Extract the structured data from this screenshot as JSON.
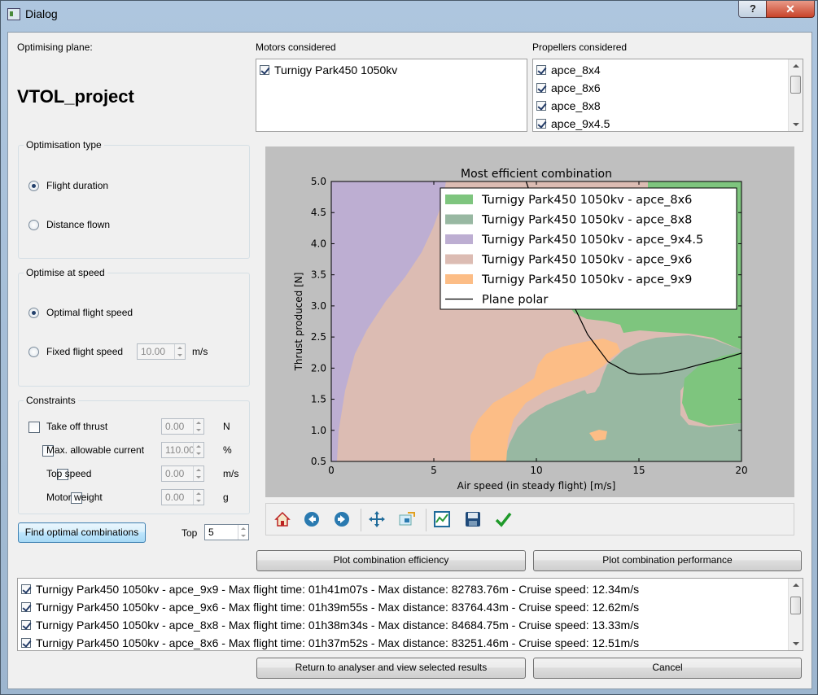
{
  "window": {
    "title": "Dialog",
    "help_label": "?",
    "close_label": "✕"
  },
  "plane": {
    "heading": "Optimising plane:",
    "name": "VTOL_project"
  },
  "motors": {
    "heading": "Motors considered",
    "items": [
      {
        "label": "Turnigy Park450 1050kv",
        "checked": true
      }
    ]
  },
  "propellers": {
    "heading": "Propellers considered",
    "items": [
      {
        "label": "apce_8x4",
        "checked": true
      },
      {
        "label": "apce_8x6",
        "checked": true
      },
      {
        "label": "apce_8x8",
        "checked": true
      },
      {
        "label": "apce_9x4.5",
        "checked": true
      }
    ]
  },
  "optimisation_type": {
    "title": "Optimisation type",
    "options": [
      {
        "label": "Flight duration",
        "selected": true
      },
      {
        "label": "Distance flown",
        "selected": false
      }
    ]
  },
  "optimise_speed": {
    "title": "Optimise at speed",
    "optimal_label": "Optimal flight speed",
    "fixed_label": "Fixed flight speed",
    "fixed_value": "10.00",
    "fixed_unit": "m/s",
    "selected": "optimal"
  },
  "constraints": {
    "title": "Constraints",
    "items": [
      {
        "label": "Take off thrust",
        "value": "0.00",
        "unit": "N"
      },
      {
        "label": "Max. allowable current",
        "value": "110.00",
        "unit": "%"
      },
      {
        "label": "Top speed",
        "value": "0.00",
        "unit": "m/s"
      },
      {
        "label": "Motor weight",
        "value": "0.00",
        "unit": "g"
      }
    ]
  },
  "find": {
    "button_label": "Find optimal combinations",
    "top_label": "Top",
    "top_value": "5"
  },
  "chart_data": {
    "type": "area",
    "title": "Most efficient combination",
    "xlabel": "Air speed (in steady flight) [m/s]",
    "ylabel": "Thrust produced [N]",
    "xlim": [
      0,
      20
    ],
    "ylim": [
      0.5,
      5.0
    ],
    "x_ticks": [
      "0",
      "5",
      "10",
      "15",
      "20"
    ],
    "y_ticks": [
      "0.5",
      "1.0",
      "1.5",
      "2.0",
      "2.5",
      "3.0",
      "3.5",
      "4.0",
      "4.5",
      "5.0"
    ],
    "legend_position": "top-right",
    "series": [
      {
        "name": "Turnigy Park450 1050kv - apce_8x6",
        "color": "#7ec57e"
      },
      {
        "name": "Turnigy Park450 1050kv - apce_8x8",
        "color": "#98b8a2"
      },
      {
        "name": "Turnigy Park450 1050kv - apce_9x4.5",
        "color": "#bdaed2"
      },
      {
        "name": "Turnigy Park450 1050kv - apce_9x6",
        "color": "#dcbcb3"
      },
      {
        "name": "Turnigy Park450 1050kv - apce_9x9",
        "color": "#fcbd86"
      }
    ],
    "line": {
      "name": "Plane polar",
      "color": "#000000",
      "x": [
        9.5,
        10.5,
        11.5,
        12.5,
        13.5,
        14.5,
        15.0,
        16.0,
        17.0,
        18.0,
        19.0,
        20.0
      ],
      "y": [
        5.0,
        4.04,
        3.22,
        2.54,
        2.1,
        1.92,
        1.9,
        1.91,
        1.97,
        2.06,
        2.14,
        2.24
      ]
    }
  },
  "toolbar": {
    "icons": [
      "home-icon",
      "back-icon",
      "forward-icon",
      "pan-icon",
      "zoom-icon",
      "subplots-icon",
      "save-icon",
      "check-icon"
    ]
  },
  "plot_buttons": {
    "efficiency": "Plot combination efficiency",
    "performance": "Plot combination performance"
  },
  "results": {
    "items": [
      {
        "label": "Turnigy Park450 1050kv - apce_9x9 - Max flight time: 01h41m07s - Max distance: 82783.76m - Cruise speed: 12.34m/s",
        "checked": true
      },
      {
        "label": "Turnigy Park450 1050kv - apce_9x6 - Max flight time: 01h39m55s - Max distance: 83764.43m - Cruise speed: 12.62m/s",
        "checked": true
      },
      {
        "label": "Turnigy Park450 1050kv - apce_8x8 - Max flight time: 01h38m34s - Max distance: 84684.75m - Cruise speed: 13.33m/s",
        "checked": true
      },
      {
        "label": "Turnigy Park450 1050kv - apce_8x6 - Max flight time: 01h37m52s - Max distance: 83251.46m - Cruise speed: 12.51m/s",
        "checked": true
      }
    ]
  },
  "footer": {
    "return_label": "Return to analyser and view selected results",
    "cancel_label": "Cancel"
  }
}
